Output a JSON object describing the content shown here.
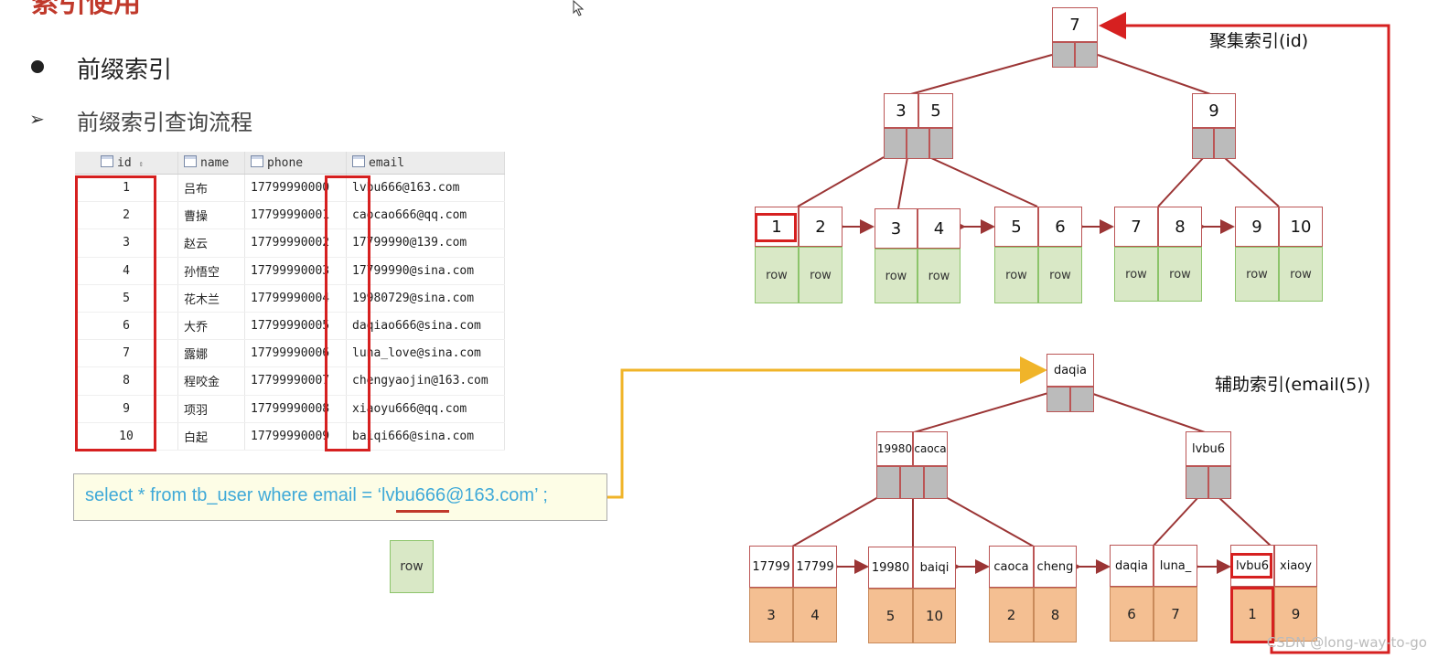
{
  "slide": {
    "title_fragment": "索引使用",
    "bullet_main": "前缀索引",
    "bullet_sub": "前缀索引查询流程"
  },
  "table": {
    "headers": [
      "id",
      "name",
      "phone",
      "email"
    ],
    "rows": [
      [
        "1",
        "吕布",
        "17799990000",
        "lvbu666@163.com"
      ],
      [
        "2",
        "曹操",
        "17799990001",
        "caocao666@qq.com"
      ],
      [
        "3",
        "赵云",
        "17799990002",
        "17799990@139.com"
      ],
      [
        "4",
        "孙悟空",
        "17799990003",
        "17799990@sina.com"
      ],
      [
        "5",
        "花木兰",
        "17799990004",
        "19980729@sina.com"
      ],
      [
        "6",
        "大乔",
        "17799990005",
        "daqiao666@sina.com"
      ],
      [
        "7",
        "露娜",
        "17799990006",
        "luna_love@sina.com"
      ],
      [
        "8",
        "程咬金",
        "17799990007",
        "chengyaojin@163.com"
      ],
      [
        "9",
        "项羽",
        "17799990008",
        "xiaoyu666@qq.com"
      ],
      [
        "10",
        "白起",
        "17799990009",
        "baiqi666@sina.com"
      ]
    ]
  },
  "sql": "select * from tb_user where email = ‘lvbu666@163.com’ ;",
  "row_label": "row",
  "clustered": {
    "label": "聚集索引(id)",
    "root": "7",
    "mid_left": [
      "3",
      "5"
    ],
    "mid_right": "9",
    "leaves": [
      [
        "1",
        "2"
      ],
      [
        "3",
        "4"
      ],
      [
        "5",
        "6"
      ],
      [
        "7",
        "8"
      ],
      [
        "9",
        "10"
      ]
    ]
  },
  "secondary": {
    "label": "辅助索引(email(5))",
    "root": "daqia",
    "mid_left": [
      "19980",
      "caoca"
    ],
    "mid_right": "lvbu6",
    "leaves": [
      [
        "17799",
        "17799"
      ],
      [
        "19980",
        "baiqi"
      ],
      [
        "caoca",
        "cheng"
      ],
      [
        "daqia",
        "luna_"
      ],
      [
        "lvbu6",
        "xiaoy"
      ]
    ],
    "leaf_ids": [
      [
        "3",
        "4"
      ],
      [
        "5",
        "10"
      ],
      [
        "2",
        "8"
      ],
      [
        "6",
        "7"
      ],
      [
        "1",
        "9"
      ]
    ]
  },
  "watermark": "CSDN @long-way-to-go",
  "colors": {
    "highlight_red": "#d62020",
    "sql_text": "#3fa9d8",
    "sql_arrow": "#f0b429",
    "tree_line": "#9b3535",
    "leaf_green": "#d9e8c6",
    "leaf_orange": "#f4bf92"
  }
}
